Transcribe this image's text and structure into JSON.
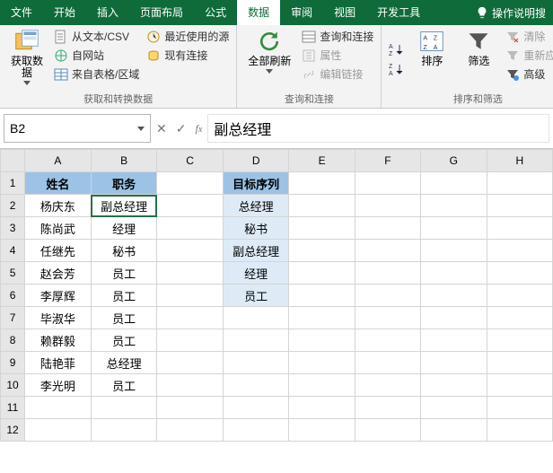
{
  "menu": {
    "tabs": [
      "文件",
      "开始",
      "插入",
      "页面布局",
      "公式",
      "数据",
      "审阅",
      "视图",
      "开发工具"
    ],
    "active_index": 5,
    "help_icon": "lightbulb",
    "help_text": "操作说明搜"
  },
  "ribbon": {
    "group1": {
      "bigbtn": "获取数\n据",
      "items": [
        "从文本/CSV",
        "自网站",
        "来自表格/区域",
        "最近使用的源",
        "现有连接"
      ],
      "label": "获取和转换数据"
    },
    "group2": {
      "bigbtn": "全部刷新",
      "items": [
        "查询和连接",
        "属性",
        "编辑链接"
      ],
      "label": "查询和连接"
    },
    "group3": {
      "sort_asc": "A→Z",
      "sort_desc": "Z→A",
      "sort_btn": "排序",
      "filter_btn": "筛选",
      "clear": "清除",
      "reapply": "重新应用",
      "advanced": "高级",
      "label": "排序和筛选"
    }
  },
  "namebox": "B2",
  "formula": "副总经理",
  "chart_data": {
    "type": "table",
    "columns": [
      "A",
      "B",
      "C",
      "D",
      "E",
      "F",
      "G",
      "H"
    ],
    "tables": [
      {
        "range": "A1:B10",
        "headers": [
          "姓名",
          "职务"
        ],
        "rows": [
          [
            "杨庆东",
            "副总经理"
          ],
          [
            "陈尚武",
            "经理"
          ],
          [
            "任继先",
            "秘书"
          ],
          [
            "赵会芳",
            "员工"
          ],
          [
            "李厚辉",
            "员工"
          ],
          [
            "毕淑华",
            "员工"
          ],
          [
            "赖群毅",
            "员工"
          ],
          [
            "陆艳菲",
            "总经理"
          ],
          [
            "李光明",
            "员工"
          ]
        ]
      },
      {
        "range": "D1:D6",
        "headers": [
          "目标序列"
        ],
        "rows": [
          [
            "总经理"
          ],
          [
            "秘书"
          ],
          [
            "副总经理"
          ],
          [
            "经理"
          ],
          [
            "员工"
          ]
        ]
      }
    ]
  },
  "selected_cell": "B2"
}
